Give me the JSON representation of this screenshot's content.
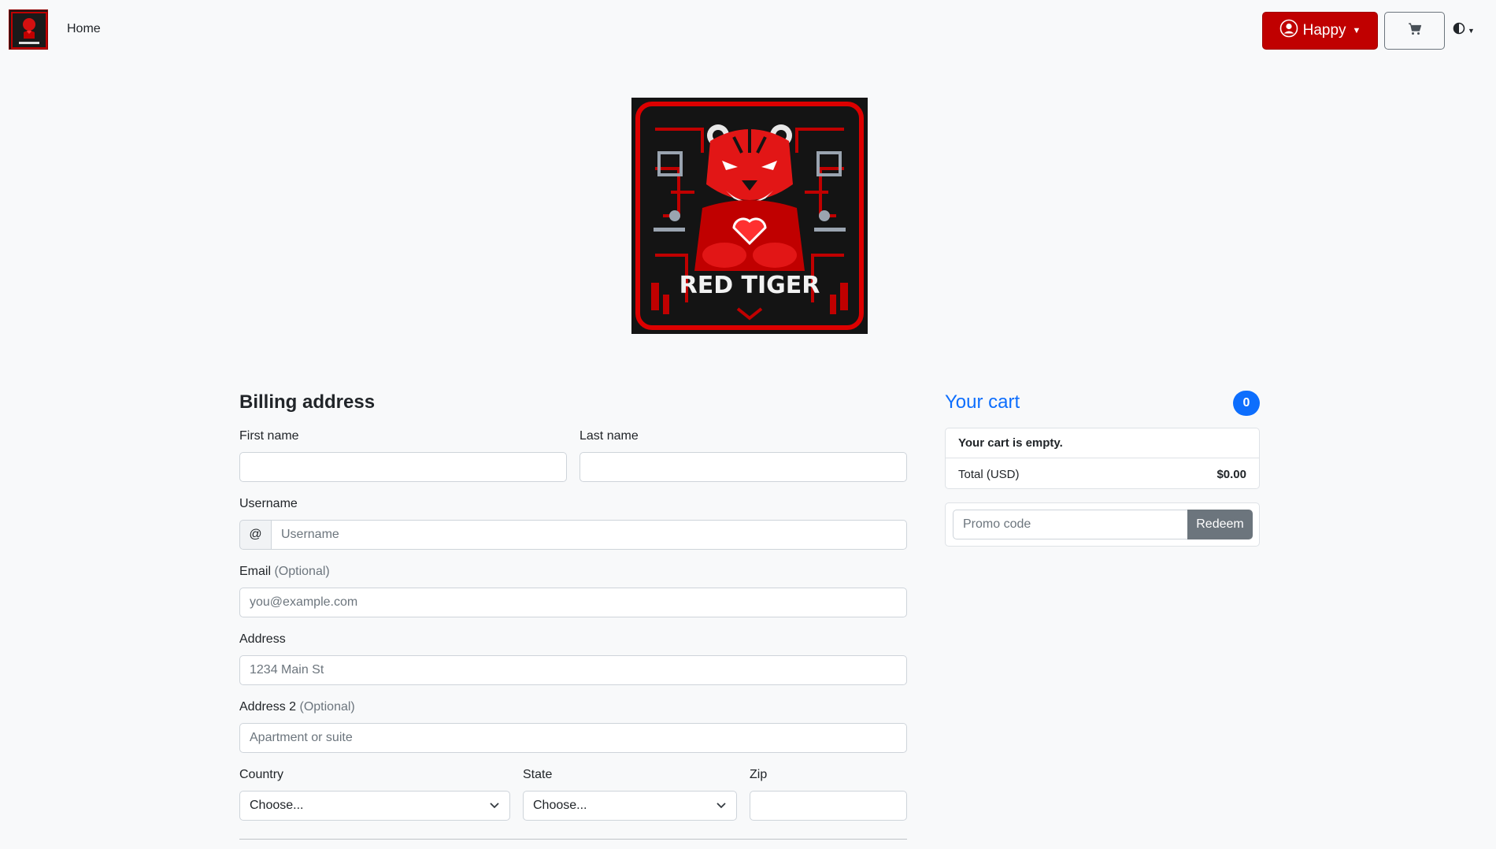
{
  "navbar": {
    "home_label": "Home",
    "user_label": "Happy",
    "brand_logo_icon": "red-tiger-logo-icon",
    "cart_icon": "cart-icon",
    "theme_icon": "contrast-icon"
  },
  "hero": {
    "logo_text": "RED TIGER",
    "colors": {
      "accent": "#c00000",
      "background": "#141414"
    }
  },
  "billing": {
    "title": "Billing address",
    "first_name": {
      "label": "First name",
      "value": ""
    },
    "last_name": {
      "label": "Last name",
      "value": ""
    },
    "username": {
      "label": "Username",
      "prefix": "@",
      "placeholder": "Username"
    },
    "email": {
      "label": "Email",
      "optional": "(Optional)",
      "placeholder": "you@example.com"
    },
    "address": {
      "label": "Address",
      "placeholder": "1234 Main St"
    },
    "address2": {
      "label": "Address 2",
      "optional": "(Optional)",
      "placeholder": "Apartment or suite"
    },
    "country": {
      "label": "Country",
      "selected": "Choose..."
    },
    "state": {
      "label": "State",
      "selected": "Choose..."
    },
    "zip": {
      "label": "Zip",
      "value": ""
    }
  },
  "cart": {
    "title": "Your cart",
    "count": "0",
    "empty_text": "Your cart is empty.",
    "total_label": "Total (USD)",
    "total_value": "$0.00",
    "promo_placeholder": "Promo code",
    "redeem_label": "Redeem"
  },
  "colors": {
    "brand_red": "#c00000",
    "primary_blue": "#0d6efd",
    "secondary_gray": "#6c757d"
  }
}
